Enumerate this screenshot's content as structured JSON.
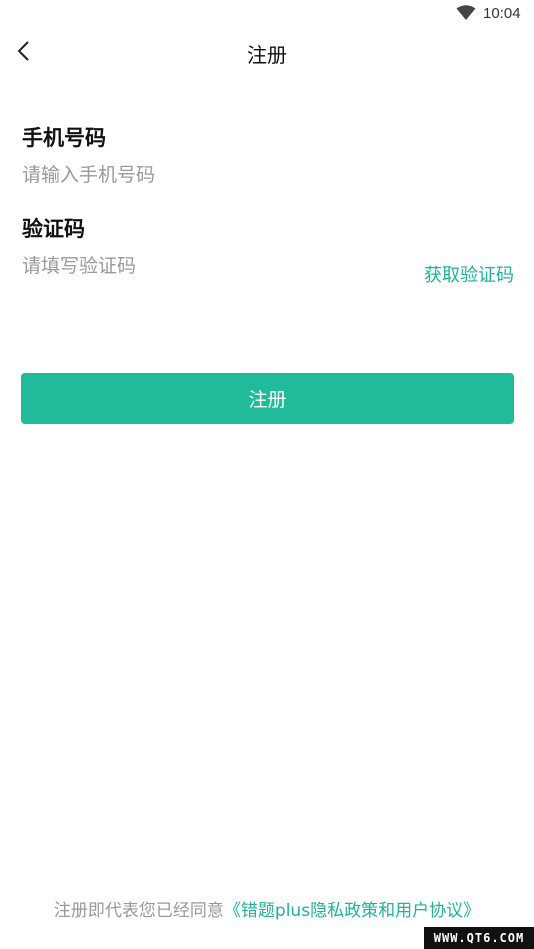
{
  "status_bar": {
    "time": "10:04",
    "wifi_icon": "wifi-icon"
  },
  "header": {
    "title": "注册",
    "back_icon": "chevron-left-icon"
  },
  "form": {
    "phone": {
      "label": "手机号码",
      "placeholder": "请输入手机号码",
      "value": ""
    },
    "code": {
      "label": "验证码",
      "placeholder": "请填写验证码",
      "value": "",
      "get_code_label": "获取验证码"
    },
    "submit_label": "注册"
  },
  "footer": {
    "agreement_prefix": "注册即代表您已经同意",
    "agreement_link": "《错题plus隐私政策和用户协议》"
  },
  "watermark": "WWW.QT6.COM",
  "colors": {
    "accent": "#20bc9a",
    "link": "#1fb495",
    "placeholder": "#9a9a9a"
  }
}
